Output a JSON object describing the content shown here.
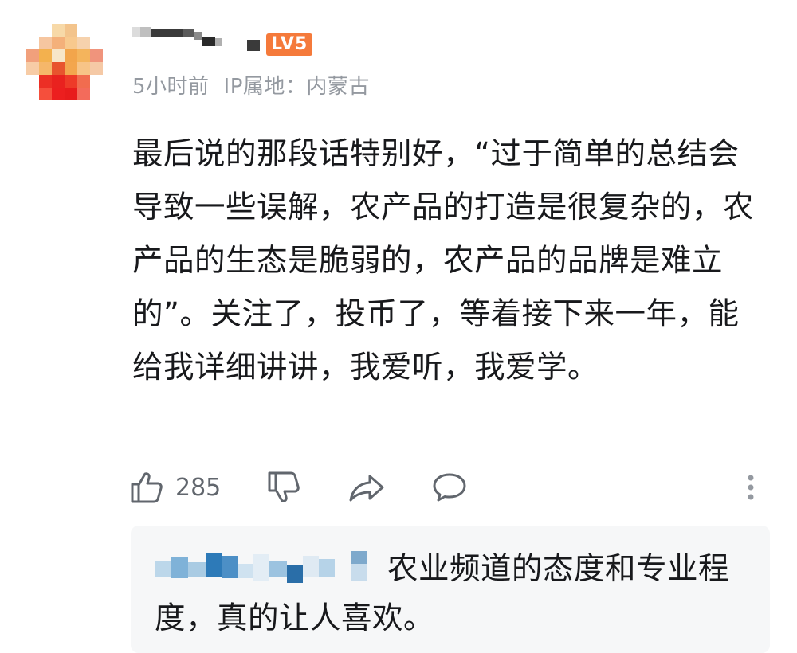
{
  "comment": {
    "level": "LV5",
    "time": "5小时前",
    "ip_location": "IP属地：内蒙古",
    "text": "最后说的那段话特别好，“过于简单的总结会导致一些误解，农产品的打造是很复杂的，农产品的生态是脆弱的，农产品的品牌是难立的”。关注了，投币了，等着接下来一年，能给我详细讲讲，我爱听，我爱学。",
    "like_count": "285"
  },
  "reply": {
    "text": "农业频道的态度和专业程度，真的让人喜欢。"
  },
  "icons": {
    "like": "thumbs-up-icon",
    "dislike": "thumbs-down-icon",
    "share": "share-icon",
    "reply": "comment-bubble-icon",
    "more": "more-vertical-icon"
  },
  "colors": {
    "level_badge": "#f57a3b",
    "meta_text": "#9499a0",
    "icon": "#61666d",
    "reply_bg": "#f6f7f8"
  }
}
